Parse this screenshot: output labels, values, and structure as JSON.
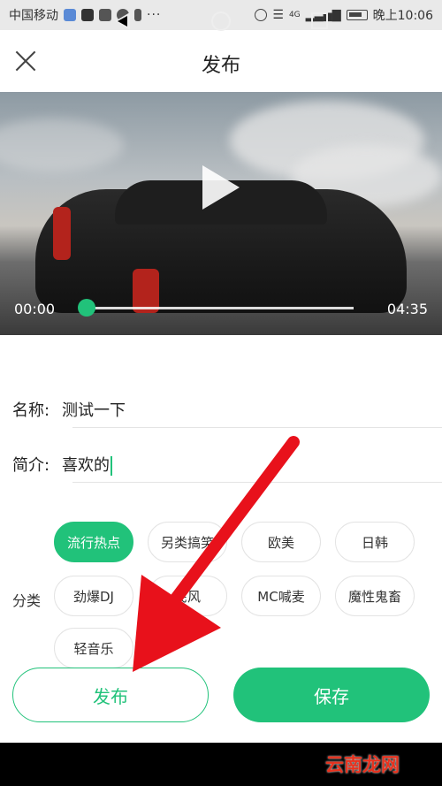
{
  "status_bar": {
    "carrier": "中国移动",
    "network": "4G",
    "time": "晚上10:06",
    "dots": "···"
  },
  "header": {
    "title": "发布"
  },
  "video": {
    "current_time": "00:00",
    "duration": "04:35",
    "progress": 0
  },
  "form": {
    "name_label": "名称:",
    "name_value": "测试一下",
    "intro_label": "简介:",
    "intro_value": "喜欢的"
  },
  "category": {
    "label": "分类",
    "chips": [
      {
        "label": "流行热点",
        "selected": true
      },
      {
        "label": "另类搞笑",
        "selected": false
      },
      {
        "label": "欧美",
        "selected": false
      },
      {
        "label": "日韩",
        "selected": false
      },
      {
        "label": "劲爆DJ",
        "selected": false
      },
      {
        "label": "民风",
        "selected": false
      },
      {
        "label": "MC喊麦",
        "selected": false
      },
      {
        "label": "魔性鬼畜",
        "selected": false
      },
      {
        "label": "轻音乐",
        "selected": false
      }
    ]
  },
  "buttons": {
    "publish": "发布",
    "save": "保存"
  },
  "watermark": "云南龙网",
  "colors": {
    "accent": "#21c27a",
    "arrow": "#e8111b"
  }
}
